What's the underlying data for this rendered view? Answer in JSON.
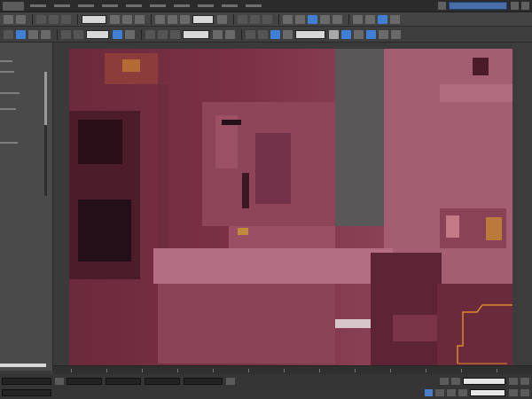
{
  "window": {
    "menus": [
      "",
      "",
      "",
      "",
      "",
      "",
      "",
      "",
      "",
      ""
    ]
  },
  "toolbar_main": {
    "buttons": [
      "",
      "",
      "",
      "",
      "",
      "",
      "",
      "",
      "",
      "",
      "",
      "",
      "",
      "",
      ""
    ]
  },
  "toolbar_secondary": {
    "buttons": []
  },
  "command_panel": {},
  "viewport": {
    "label": ""
  },
  "status": {},
  "colors": {
    "viewport_bg": "#7a2f43",
    "ui_dark": "#2b2b2b",
    "ui_mid": "#444444",
    "accent_blue": "#3f7fd6",
    "highlight_orange": "#d98a2b"
  },
  "icons": [
    "app-logo-icon",
    "undo-icon",
    "redo-icon",
    "select-icon",
    "move-icon",
    "rotate-icon",
    "scale-icon",
    "snap-icon",
    "render-icon",
    "play-icon"
  ]
}
